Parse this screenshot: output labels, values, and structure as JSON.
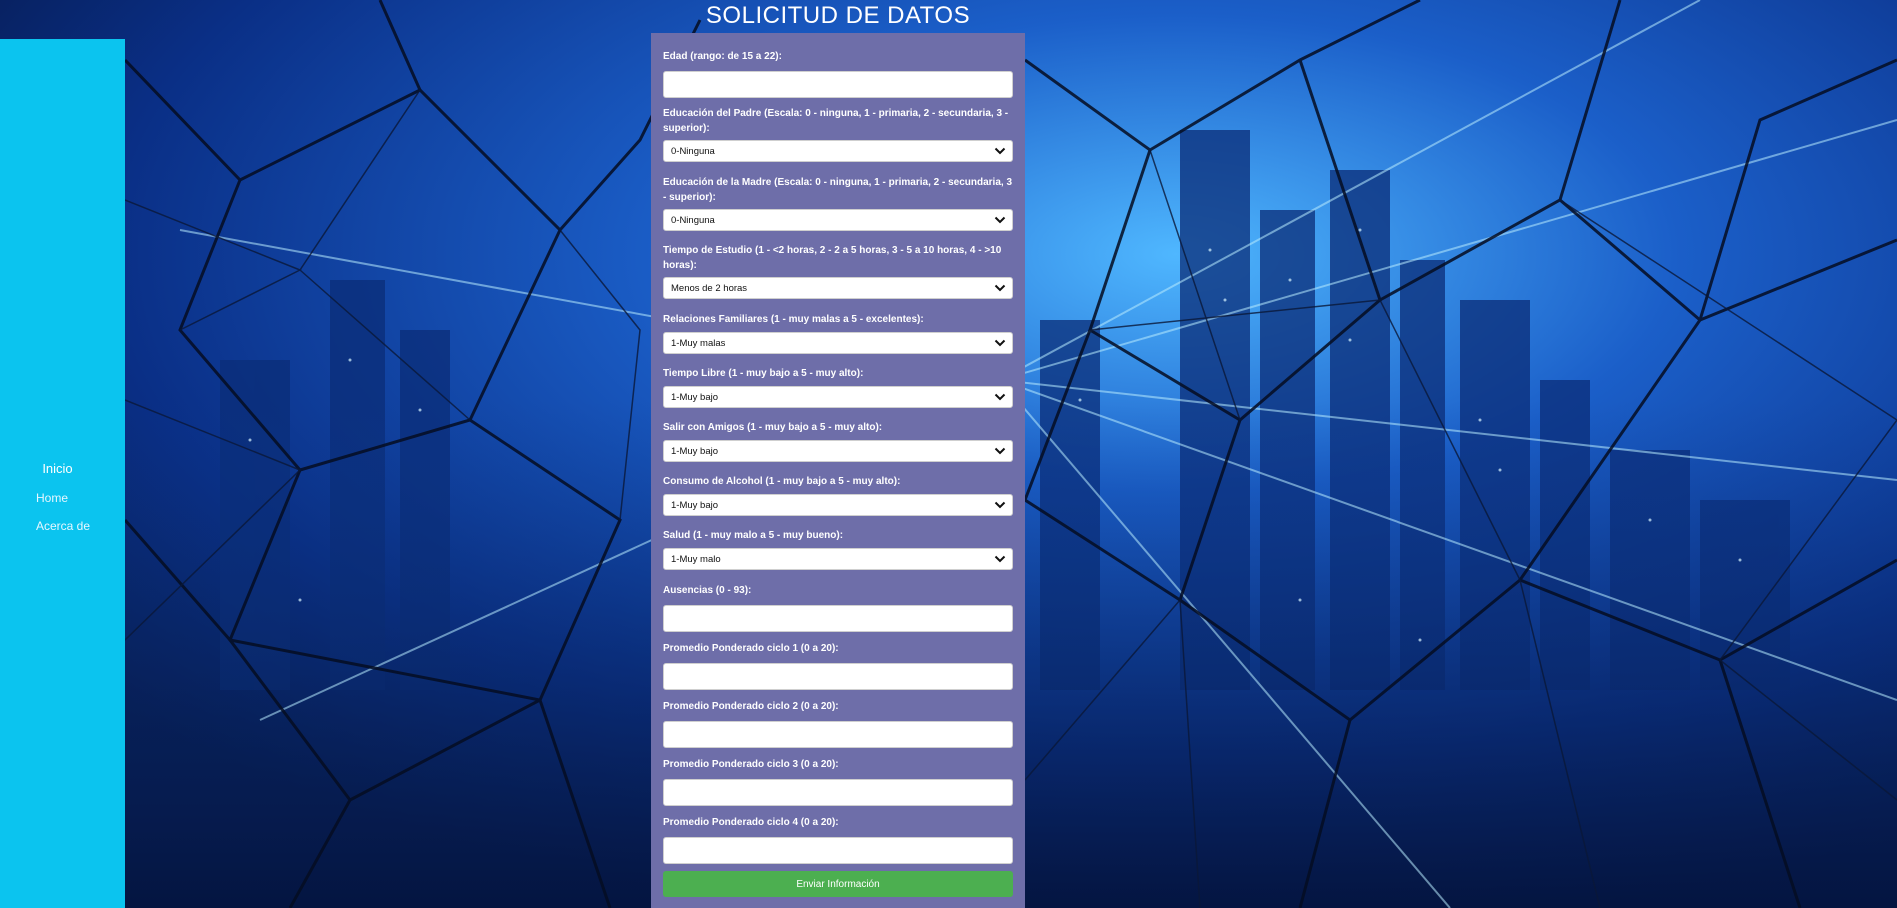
{
  "colors": {
    "sidebar_bg": "#0bc4ef",
    "form_bg": "#6e6ea9",
    "submit_bg": "#4caf50",
    "background": "#08255e"
  },
  "sidebar": {
    "title": "Inicio",
    "items": [
      {
        "label": "Home"
      },
      {
        "label": "Acerca de"
      }
    ]
  },
  "form": {
    "title": "SOLICITUD DE DATOS",
    "fields": [
      {
        "label": "Edad (rango: de 15 a 22):",
        "type": "input",
        "value": "",
        "placeholder": ""
      },
      {
        "label": "Educación del Padre (Escala: 0 - ninguna, 1 - primaria, 2 - secundaria, 3 - superior):",
        "type": "select",
        "value": "0-Ninguna"
      },
      {
        "label": "Educación de la Madre (Escala: 0 - ninguna, 1 - primaria, 2 - secundaria, 3 - superior):",
        "type": "select",
        "value": "0-Ninguna"
      },
      {
        "label": "Tiempo de Estudio (1 - <2 horas, 2 - 2 a 5 horas, 3 - 5 a 10 horas, 4 - >10 horas):",
        "type": "select",
        "value": "Menos de 2 horas"
      },
      {
        "label": "Relaciones Familiares (1 - muy malas a 5 - excelentes):",
        "type": "select",
        "value": "1-Muy malas"
      },
      {
        "label": "Tiempo Libre (1 - muy bajo a 5 - muy alto):",
        "type": "select",
        "value": "1-Muy bajo"
      },
      {
        "label": "Salir con Amigos (1 - muy bajo a 5 - muy alto):",
        "type": "select",
        "value": "1-Muy bajo"
      },
      {
        "label": "Consumo de Alcohol (1 - muy bajo a 5 - muy alto):",
        "type": "select",
        "value": "1-Muy bajo"
      },
      {
        "label": "Salud (1 - muy malo a 5 - muy bueno):",
        "type": "select",
        "value": "1-Muy malo"
      },
      {
        "label": "Ausencias (0 - 93):",
        "type": "input",
        "value": "",
        "placeholder": ""
      },
      {
        "label": "Promedio Ponderado ciclo 1 (0 a 20):",
        "type": "input",
        "value": "",
        "placeholder": ""
      },
      {
        "label": "Promedio Ponderado ciclo 2 (0 a 20):",
        "type": "input",
        "value": "",
        "placeholder": ""
      },
      {
        "label": "Promedio Ponderado ciclo 3 (0 a 20):",
        "type": "input",
        "value": "",
        "placeholder": ""
      },
      {
        "label": "Promedio Ponderado ciclo 4 (0 a 20):",
        "type": "input",
        "value": "",
        "placeholder": ""
      }
    ],
    "submit_label": "Enviar Información",
    "chevron_icon": "chevron-down-icon"
  }
}
